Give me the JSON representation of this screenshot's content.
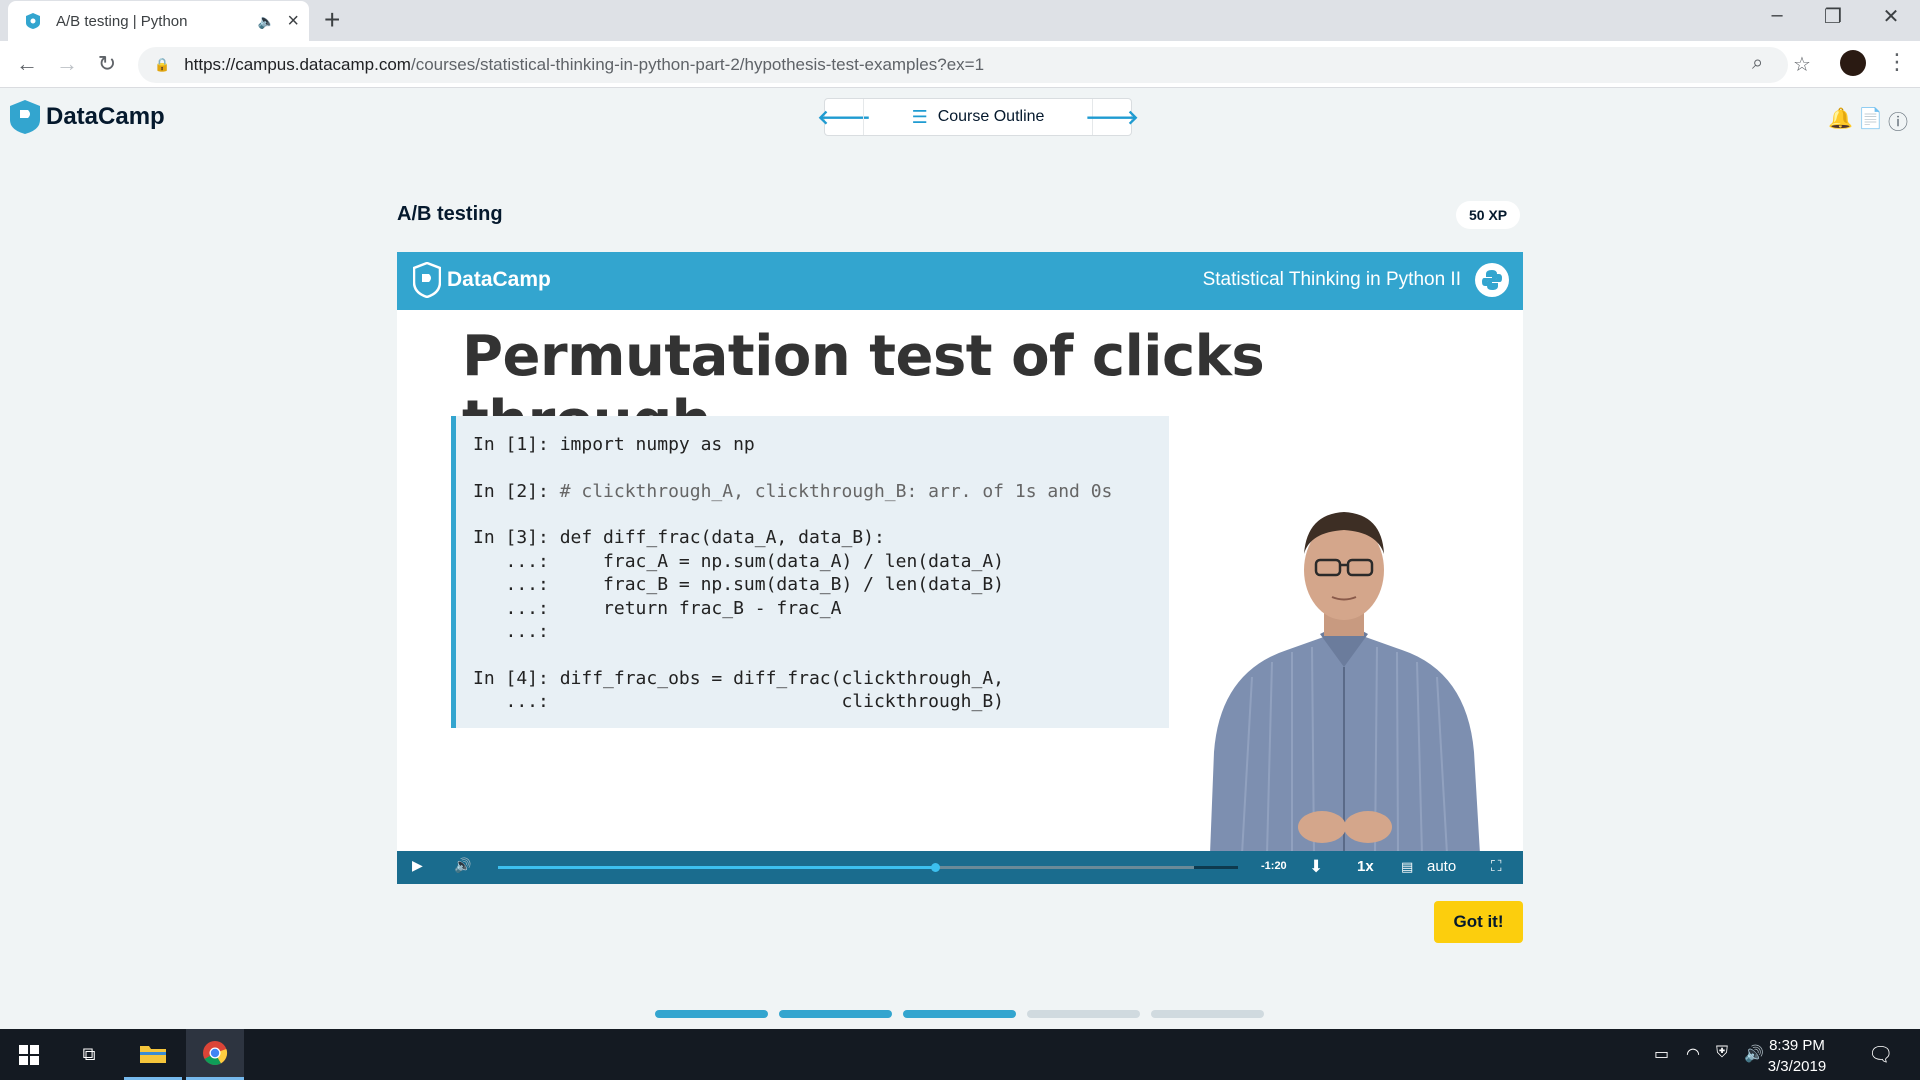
{
  "browser": {
    "tab_title": "A/B testing | Python",
    "url_host": "https://campus.datacamp.com",
    "url_path": "/courses/statistical-thinking-in-python-part-2/hypothesis-test-examples?ex=1"
  },
  "header": {
    "brand": "DataCamp",
    "course_outline": "Course Outline"
  },
  "exercise": {
    "title": "A/B testing",
    "xp": "50 XP",
    "got_it": "Got it!"
  },
  "video": {
    "brand": "DataCamp",
    "course_name": "Statistical Thinking in Python II",
    "slide_title": "Permutation test of clicks through",
    "code": [
      {
        "text": "In [1]: import numpy as np",
        "comment": ""
      },
      {
        "text": "",
        "comment": ""
      },
      {
        "text": "In [2]: ",
        "comment": "# clickthrough_A, clickthrough_B: arr. of 1s and 0s"
      },
      {
        "text": "",
        "comment": ""
      },
      {
        "text": "In [3]: def diff_frac(data_A, data_B):",
        "comment": ""
      },
      {
        "text": "   ...:     frac_A = np.sum(data_A) / len(data_A)",
        "comment": ""
      },
      {
        "text": "   ...:     frac_B = np.sum(data_B) / len(data_B)",
        "comment": ""
      },
      {
        "text": "   ...:     return frac_B - frac_A",
        "comment": ""
      },
      {
        "text": "   ...:",
        "comment": ""
      },
      {
        "text": "",
        "comment": ""
      },
      {
        "text": "In [4]: diff_frac_obs = diff_frac(clickthrough_A,",
        "comment": ""
      },
      {
        "text": "   ...:                           clickthrough_B)",
        "comment": ""
      }
    ],
    "controls": {
      "time_remaining": "-1:20",
      "speed": "1x",
      "quality": "auto",
      "progress": 0.59,
      "buffered": 0.94
    }
  },
  "slide_progress": {
    "total": 5,
    "completed": 3
  },
  "taskbar": {
    "time": "8:39 PM",
    "date": "3/3/2019"
  },
  "colors": {
    "accent": "#33a5cf",
    "controls": "#1a6c8e",
    "cta": "#fcce0d"
  }
}
